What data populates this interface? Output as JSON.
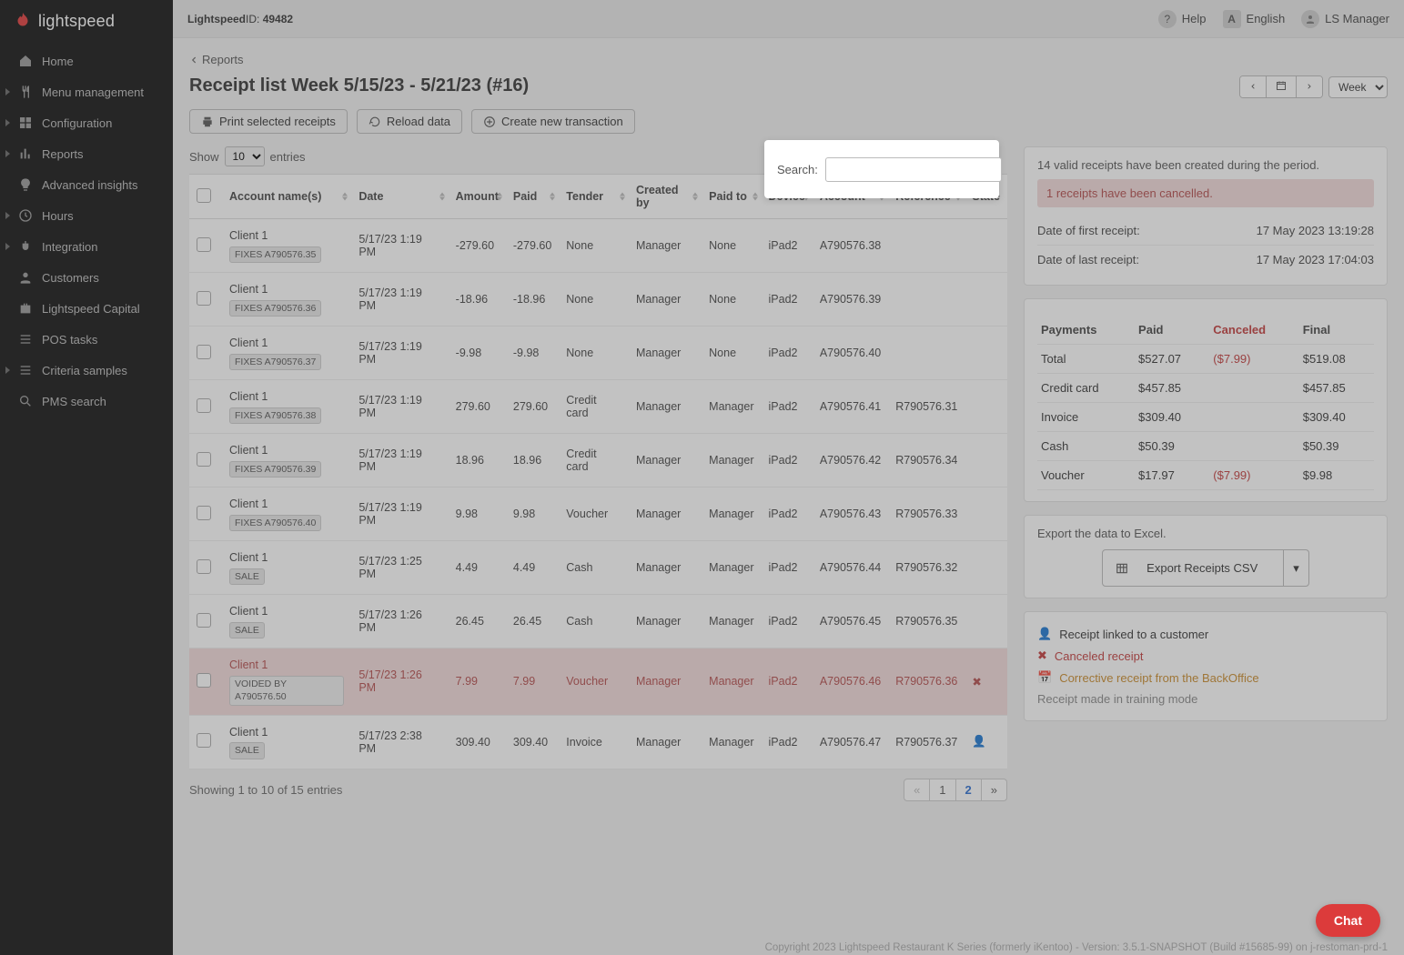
{
  "brand": {
    "name": "lightspeed"
  },
  "topbar": {
    "company": "Lightspeed",
    "id_label": "ID:",
    "id_value": "49482",
    "help": "Help",
    "lang": "English",
    "user": "LS Manager"
  },
  "sidebar": {
    "home": "Home",
    "menu_mgmt": "Menu management",
    "configuration": "Configuration",
    "reports": "Reports",
    "adv_insights": "Advanced insights",
    "hours": "Hours",
    "integration": "Integration",
    "customers": "Customers",
    "ls_capital": "Lightspeed Capital",
    "pos_tasks": "POS tasks",
    "criteria": "Criteria samples",
    "pms": "PMS search"
  },
  "breadcrumb": {
    "parent": "Reports"
  },
  "page_title": "Receipt list Week 5/15/23 - 5/21/23 (#16)",
  "date_ctrl": {
    "period": "Week"
  },
  "toolbar": {
    "print": "Print selected receipts",
    "reload": "Reload data",
    "create": "Create new transaction"
  },
  "length": {
    "show": "Show",
    "entries": "entries",
    "value": "10"
  },
  "search": {
    "label": "Search:",
    "value": ""
  },
  "columns": {
    "chk": "",
    "account_names": "Account name(s)",
    "date": "Date",
    "amount": "Amount",
    "paid": "Paid",
    "tender": "Tender",
    "created_by": "Created by",
    "paid_to": "Paid to",
    "device": "Device",
    "account": "Account",
    "reference": "Reference",
    "state": "State"
  },
  "rows": [
    {
      "client": "Client 1",
      "badge": "FIXES A790576.35",
      "date": "5/17/23 1:19 PM",
      "amount": "-279.60",
      "paid": "-279.60",
      "tender": "None",
      "created_by": "Manager",
      "paid_to": "None",
      "device": "iPad2",
      "account": "A790576.38",
      "reference": "",
      "state": "",
      "cancelled": false
    },
    {
      "client": "Client 1",
      "badge": "FIXES A790576.36",
      "date": "5/17/23 1:19 PM",
      "amount": "-18.96",
      "paid": "-18.96",
      "tender": "None",
      "created_by": "Manager",
      "paid_to": "None",
      "device": "iPad2",
      "account": "A790576.39",
      "reference": "",
      "state": "",
      "cancelled": false
    },
    {
      "client": "Client 1",
      "badge": "FIXES A790576.37",
      "date": "5/17/23 1:19 PM",
      "amount": "-9.98",
      "paid": "-9.98",
      "tender": "None",
      "created_by": "Manager",
      "paid_to": "None",
      "device": "iPad2",
      "account": "A790576.40",
      "reference": "",
      "state": "",
      "cancelled": false
    },
    {
      "client": "Client 1",
      "badge": "FIXES A790576.38",
      "date": "5/17/23 1:19 PM",
      "amount": "279.60",
      "paid": "279.60",
      "tender": "Credit card",
      "created_by": "Manager",
      "paid_to": "Manager",
      "device": "iPad2",
      "account": "A790576.41",
      "reference": "R790576.31",
      "state": "",
      "cancelled": false
    },
    {
      "client": "Client 1",
      "badge": "FIXES A790576.39",
      "date": "5/17/23 1:19 PM",
      "amount": "18.96",
      "paid": "18.96",
      "tender": "Credit card",
      "created_by": "Manager",
      "paid_to": "Manager",
      "device": "iPad2",
      "account": "A790576.42",
      "reference": "R790576.34",
      "state": "",
      "cancelled": false
    },
    {
      "client": "Client 1",
      "badge": "FIXES A790576.40",
      "date": "5/17/23 1:19 PM",
      "amount": "9.98",
      "paid": "9.98",
      "tender": "Voucher",
      "created_by": "Manager",
      "paid_to": "Manager",
      "device": "iPad2",
      "account": "A790576.43",
      "reference": "R790576.33",
      "state": "",
      "cancelled": false
    },
    {
      "client": "Client 1",
      "badge": "SALE",
      "date": "5/17/23 1:25 PM",
      "amount": "4.49",
      "paid": "4.49",
      "tender": "Cash",
      "created_by": "Manager",
      "paid_to": "Manager",
      "device": "iPad2",
      "account": "A790576.44",
      "reference": "R790576.32",
      "state": "",
      "cancelled": false
    },
    {
      "client": "Client 1",
      "badge": "SALE",
      "date": "5/17/23 1:26 PM",
      "amount": "26.45",
      "paid": "26.45",
      "tender": "Cash",
      "created_by": "Manager",
      "paid_to": "Manager",
      "device": "iPad2",
      "account": "A790576.45",
      "reference": "R790576.35",
      "state": "",
      "cancelled": false
    },
    {
      "client": "Client 1",
      "badge": "VOIDED BY A790576.50",
      "date": "5/17/23 1:26 PM",
      "amount": "7.99",
      "paid": "7.99",
      "tender": "Voucher",
      "created_by": "Manager",
      "paid_to": "Manager",
      "device": "iPad2",
      "account": "A790576.46",
      "reference": "R790576.36",
      "state": "✖",
      "cancelled": true
    },
    {
      "client": "Client 1",
      "badge": "SALE",
      "date": "5/17/23 2:38 PM",
      "amount": "309.40",
      "paid": "309.40",
      "tender": "Invoice",
      "created_by": "Manager",
      "paid_to": "Manager",
      "device": "iPad2",
      "account": "A790576.47",
      "reference": "R790576.37",
      "state": "👤",
      "cancelled": false
    }
  ],
  "table_info": "Showing 1 to 10 of 15 entries",
  "pager": {
    "prev": "«",
    "p1": "1",
    "p2": "2",
    "next": "»"
  },
  "summary": {
    "valid_msg": "14 valid receipts have been created during the period.",
    "cancelled_msg": "1 receipts have been cancelled.",
    "first_label": "Date of first receipt:",
    "first_value": "17 May 2023 13:19:28",
    "last_label": "Date of last receipt:",
    "last_value": "17 May 2023 17:04:03"
  },
  "payments": {
    "headers": {
      "payments": "Payments",
      "paid": "Paid",
      "canceled": "Canceled",
      "final": "Final"
    },
    "rows": [
      {
        "name": "Total",
        "paid": "$527.07",
        "canceled": "($7.99)",
        "final": "$519.08",
        "neg": true
      },
      {
        "name": "Credit card",
        "paid": "$457.85",
        "canceled": "",
        "final": "$457.85",
        "neg": false
      },
      {
        "name": "Invoice",
        "paid": "$309.40",
        "canceled": "",
        "final": "$309.40",
        "neg": false
      },
      {
        "name": "Cash",
        "paid": "$50.39",
        "canceled": "",
        "final": "$50.39",
        "neg": false
      },
      {
        "name": "Voucher",
        "paid": "$17.97",
        "canceled": "($7.99)",
        "final": "$9.98",
        "neg": true
      }
    ]
  },
  "export": {
    "hint": "Export the data to Excel.",
    "btn": "Export Receipts CSV"
  },
  "legend": {
    "linked": "Receipt linked to a customer",
    "canceled": "Canceled receipt",
    "corrective": "Corrective receipt from the BackOffice",
    "training": "Receipt made in training mode"
  },
  "chat": "Chat",
  "copyright": "Copyright 2023 Lightspeed Restaurant K Series (formerly iKentoo) - Version: 3.5.1-SNAPSHOT (Build #15685-99) on j-restoman-prd-1"
}
